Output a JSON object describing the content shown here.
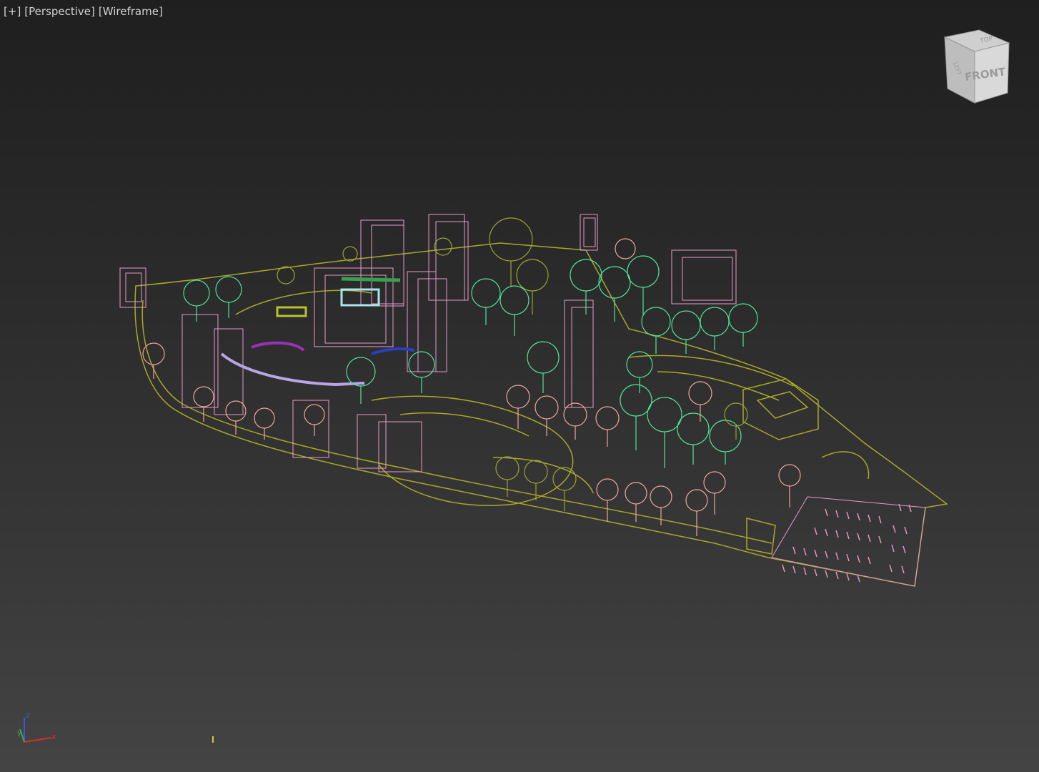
{
  "viewport": {
    "labels": [
      "+",
      "Perspective",
      "Wireframe"
    ]
  },
  "viewcube": {
    "front_label": "FRONT",
    "top_label": "TOP",
    "left_label": "LEFT"
  },
  "axis_tripod": {
    "x_label": "x",
    "y_label": "y",
    "z_label": "z"
  },
  "colors": {
    "site_outline": "#a8a829",
    "building_pink": "#e79ac9",
    "tree_green": "#4fe39a",
    "tree_salmon": "#f0a69a",
    "tree_olive": "#9ba332",
    "highlight_purple": "#9b2fb5",
    "highlight_blue": "#2a3fbf",
    "highlight_cyan": "#a8e6ea",
    "axis_x": "#d0312d",
    "axis_y": "#3ea64b",
    "axis_z": "#3b57d8"
  },
  "scene_icon": "wireframe-site-model"
}
